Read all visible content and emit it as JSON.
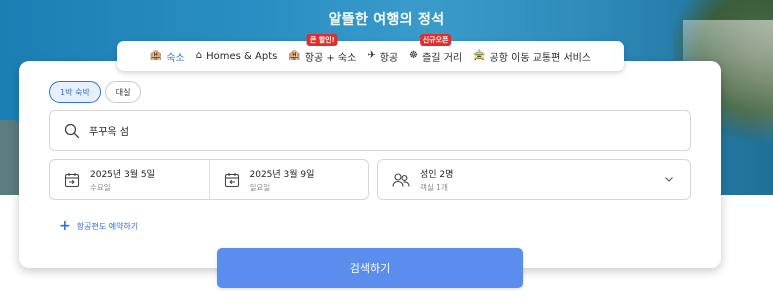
{
  "hero": {
    "title": "알뜰한 여행의 정석"
  },
  "tabs": [
    {
      "label": "숙소",
      "icon": "hotel-icon",
      "active": true,
      "badge": ""
    },
    {
      "label": "Homes & Apts",
      "icon": "home-icon",
      "active": false,
      "badge": ""
    },
    {
      "label": "항공 + 숙소",
      "icon": "flight-hotel-icon",
      "active": false,
      "badge": "큰 할인!"
    },
    {
      "label": "항공",
      "icon": "airplane-icon",
      "active": false,
      "badge": ""
    },
    {
      "label": "즐길 거리",
      "icon": "activities-icon",
      "active": false,
      "badge": "신규오픈"
    },
    {
      "label": "공항 이동 교통편 서비스",
      "icon": "car-icon",
      "active": false,
      "badge": ""
    }
  ],
  "stay_type": {
    "options": [
      "1박 숙박",
      "대실"
    ],
    "selected": "1박 숙박"
  },
  "search": {
    "value": "푸꾸옥 섬",
    "placeholder": ""
  },
  "dates": {
    "checkin": {
      "date": "2025년 3월 5일",
      "weekday": "수요일"
    },
    "checkout": {
      "date": "2025년 3월 9일",
      "weekday": "일요일"
    }
  },
  "guests": {
    "summary": "성인 2명",
    "rooms": "객실 1개"
  },
  "flight_link": {
    "label": "항공편도 예약하기"
  },
  "search_button": {
    "label": "검색하기"
  },
  "colors": {
    "accent": "#2f6fde",
    "button": "#5b8def",
    "badge": "#e12d2d"
  }
}
